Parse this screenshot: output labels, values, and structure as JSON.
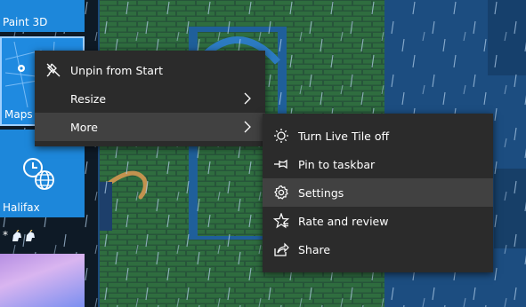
{
  "tiles": {
    "paint3d_label": "Paint 3D",
    "maps_label": "Maps",
    "halifax_label": "Halifax"
  },
  "strip_row": {
    "text": "* "
  },
  "main_menu": {
    "items": [
      {
        "label": "Unpin from Start",
        "icon": "unpin-icon"
      },
      {
        "label": "Resize",
        "icon": "",
        "has_submenu": true
      },
      {
        "label": "More",
        "icon": "",
        "has_submenu": true,
        "highlighted": true
      }
    ]
  },
  "more_menu": {
    "items": [
      {
        "label": "Turn Live Tile off",
        "icon": "live-tile-icon"
      },
      {
        "label": "Pin to taskbar",
        "icon": "pin-icon"
      },
      {
        "label": "Settings",
        "icon": "gear-icon",
        "highlighted": true
      },
      {
        "label": "Rate and review",
        "icon": "rate-review-icon"
      },
      {
        "label": "Share",
        "icon": "share-icon"
      }
    ]
  },
  "colors": {
    "tile_blue": "#1d87da",
    "menu_bg": "#2b2b2b",
    "menu_highlight": "#414141",
    "wallpaper_wall": "#1a4f85",
    "wallpaper_brick": "#2f6a3a"
  }
}
